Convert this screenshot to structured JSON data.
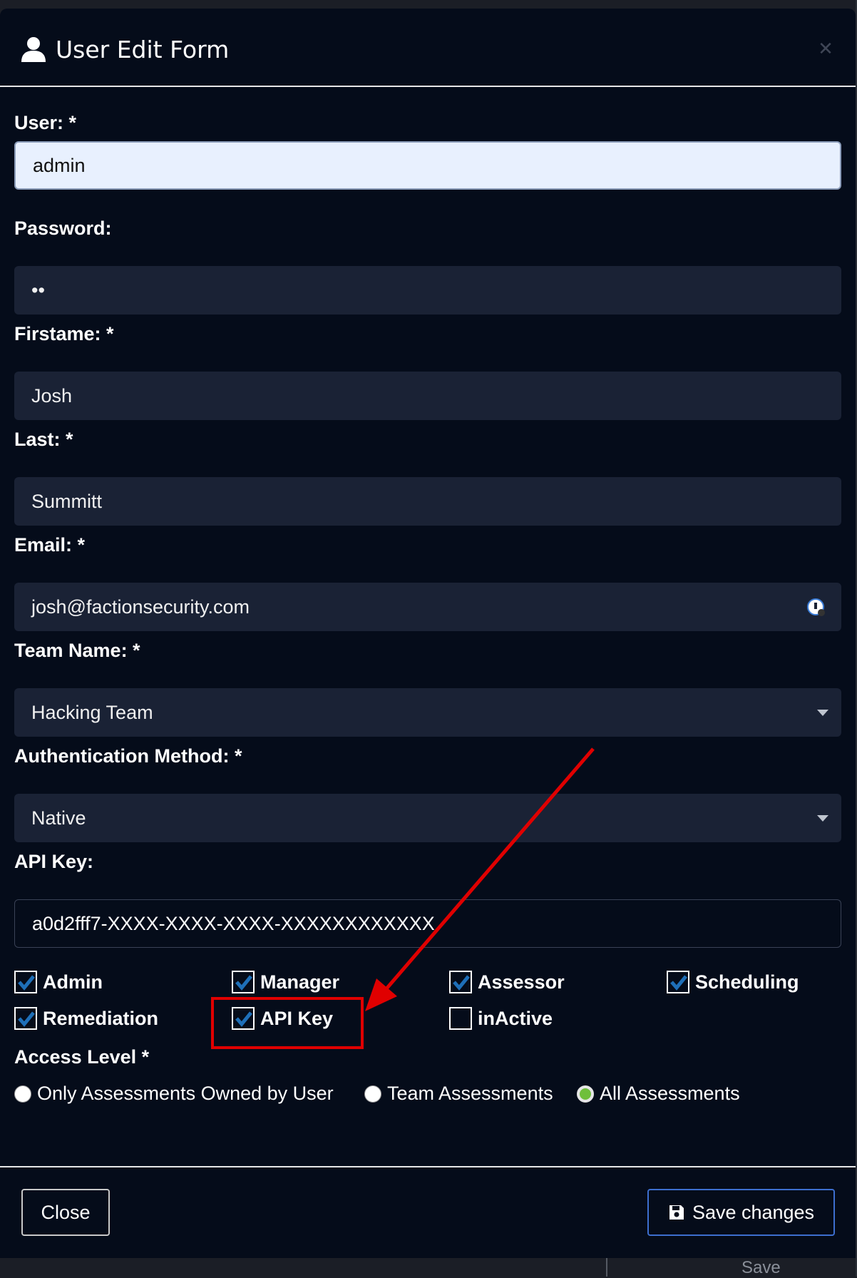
{
  "header": {
    "title": "User Edit Form"
  },
  "fields": {
    "user": {
      "label": "User: *",
      "value": "admin"
    },
    "password": {
      "label": "Password:",
      "value": "••"
    },
    "firstname": {
      "label": "Firstame: *",
      "value": "Josh"
    },
    "last": {
      "label": "Last: *",
      "value": "Summitt"
    },
    "email": {
      "label": "Email: *",
      "value": "josh@factionsecurity.com"
    },
    "team": {
      "label": "Team Name: *",
      "value": "Hacking Team"
    },
    "auth": {
      "label": "Authentication Method: *",
      "value": "Native"
    },
    "apikey": {
      "label": "API Key:",
      "value": "a0d2fff7-XXXX-XXXX-XXXX-XXXXXXXXXXXX"
    }
  },
  "roles": [
    {
      "label": "Admin",
      "checked": true
    },
    {
      "label": "Manager",
      "checked": true
    },
    {
      "label": "Assessor",
      "checked": true
    },
    {
      "label": "Scheduling",
      "checked": true
    },
    {
      "label": "Remediation",
      "checked": true
    },
    {
      "label": "API Key",
      "checked": true
    },
    {
      "label": "inActive",
      "checked": false
    }
  ],
  "access": {
    "label": "Access Level *",
    "options": [
      {
        "label": "Only Assessments Owned by User",
        "selected": false
      },
      {
        "label": "Team Assessments",
        "selected": false
      },
      {
        "label": "All Assessments",
        "selected": true
      }
    ]
  },
  "footer": {
    "close_label": "Close",
    "save_label": "Save changes"
  },
  "background": {
    "save_label": "Save"
  },
  "colors": {
    "modal_bg": "#050c1a",
    "field_bg": "#1a2235",
    "check": "#1e6fb8",
    "annotation": "#e00000",
    "radio_on": "#6fbf3b"
  }
}
